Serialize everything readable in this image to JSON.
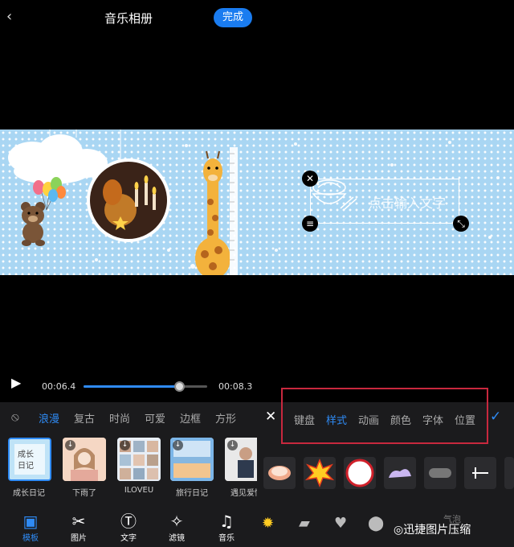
{
  "header": {
    "back_icon": "‹",
    "title": "音乐相册",
    "done_label": "完成"
  },
  "player": {
    "current_time": "00:06.4",
    "total_time": "00:08.3",
    "progress": 0.77
  },
  "categories": {
    "none_icon": "⦸",
    "items": [
      "浪漫",
      "复古",
      "时尚",
      "可爱",
      "边框",
      "方形"
    ],
    "active_index": 0
  },
  "templates": [
    {
      "label": "成长日记",
      "selected": true,
      "download": false,
      "art": "成长\n日记"
    },
    {
      "label": "下雨了",
      "selected": false,
      "download": true
    },
    {
      "label": "ILOVEU",
      "selected": false,
      "download": true
    },
    {
      "label": "旅行日记",
      "selected": false,
      "download": true
    },
    {
      "label": "遇见爱情",
      "selected": false,
      "download": true
    }
  ],
  "toolbar": [
    {
      "label": "模板",
      "icon": "template-icon",
      "glyph": "▣",
      "active": true
    },
    {
      "label": "图片",
      "icon": "scissors-icon",
      "glyph": "✂",
      "active": false
    },
    {
      "label": "文字",
      "icon": "text-icon",
      "glyph": "Ⓣ",
      "active": false
    },
    {
      "label": "滤镜",
      "icon": "filter-icon",
      "glyph": "✧",
      "active": false
    },
    {
      "label": "音乐",
      "icon": "music-icon",
      "glyph": "♫",
      "active": false
    }
  ],
  "text_editor": {
    "placeholder": "点击输入文字",
    "close_icon": "✕",
    "confirm_icon": "✓",
    "tabs": [
      "键盘",
      "样式",
      "动画",
      "颜色",
      "字体",
      "位置"
    ],
    "active_tab_index": 1
  },
  "text_box": {
    "delete_icon": "✕",
    "align_icon": "≡",
    "resize_icon": "⤡"
  },
  "watermark": {
    "text": "迅捷图片压缩",
    "partial_label": "气泡"
  },
  "colors": {
    "accent": "#2f8bf5",
    "highlight_border": "#c8283e",
    "canvas_bg": "#a9d6f3"
  }
}
